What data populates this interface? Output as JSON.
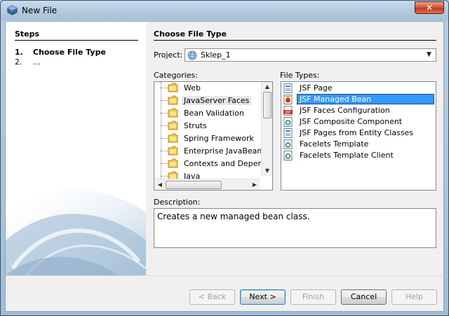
{
  "window": {
    "title": "New File",
    "close_label": "✕"
  },
  "steps": {
    "heading": "Steps",
    "items": [
      {
        "num": "1.",
        "label": "Choose File Type"
      },
      {
        "num": "2.",
        "label": "..."
      }
    ]
  },
  "main": {
    "heading": "Choose File Type",
    "project_label": "Project:",
    "project_value": "Sklep_1",
    "categories_label": "Categories:",
    "file_types_label": "File Types:",
    "description_label": "Description:",
    "description_text": "Creates a new managed bean class."
  },
  "categories": [
    {
      "label": "Web",
      "icon": "folder-icon"
    },
    {
      "label": "JavaServer Faces",
      "icon": "folder-icon",
      "selected": true
    },
    {
      "label": "Bean Validation",
      "icon": "folder-icon"
    },
    {
      "label": "Struts",
      "icon": "folder-icon"
    },
    {
      "label": "Spring Framework",
      "icon": "folder-icon"
    },
    {
      "label": "Enterprise JavaBeans",
      "icon": "folder-icon"
    },
    {
      "label": "Contexts and Depende",
      "icon": "folder-icon"
    },
    {
      "label": "Java",
      "icon": "folder-icon"
    }
  ],
  "file_types": [
    {
      "label": "JSF Page",
      "icon": "jsf-page-icon"
    },
    {
      "label": "JSF Managed Bean",
      "icon": "managed-bean-icon",
      "selected": true
    },
    {
      "label": "JSF Faces Configuration",
      "icon": "faces-config-icon"
    },
    {
      "label": "JSF Composite Component",
      "icon": "composite-component-icon"
    },
    {
      "label": "JSF Pages from Entity Classes",
      "icon": "jsf-page-icon"
    },
    {
      "label": "Facelets Template",
      "icon": "facelets-icon"
    },
    {
      "label": "Facelets Template Client",
      "icon": "facelets-icon"
    }
  ],
  "buttons": {
    "back": "< Back",
    "next": "Next >",
    "finish": "Finish",
    "cancel": "Cancel",
    "help": "Help"
  },
  "colors": {
    "selection": "#3399ff",
    "titlebar": "#b4cbe0",
    "close": "#c23a1d"
  }
}
